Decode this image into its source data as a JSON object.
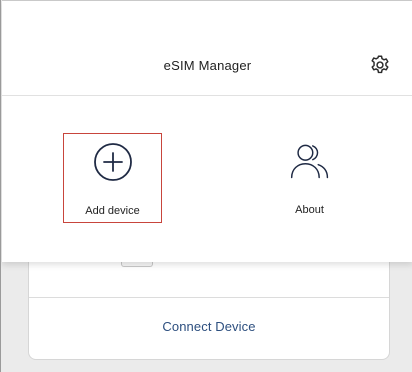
{
  "header": {
    "title": "eSIM Manager",
    "settings_icon": "gear-icon"
  },
  "menu": {
    "items": [
      {
        "label": "Add device",
        "icon": "plus-circle-icon",
        "selected": true
      },
      {
        "label": "About",
        "icon": "users-icon",
        "selected": false
      }
    ]
  },
  "card": {
    "connect_label": "Connect Device"
  },
  "colors": {
    "accent_text": "#2d4f7f",
    "selection_outline": "#c8453c"
  }
}
